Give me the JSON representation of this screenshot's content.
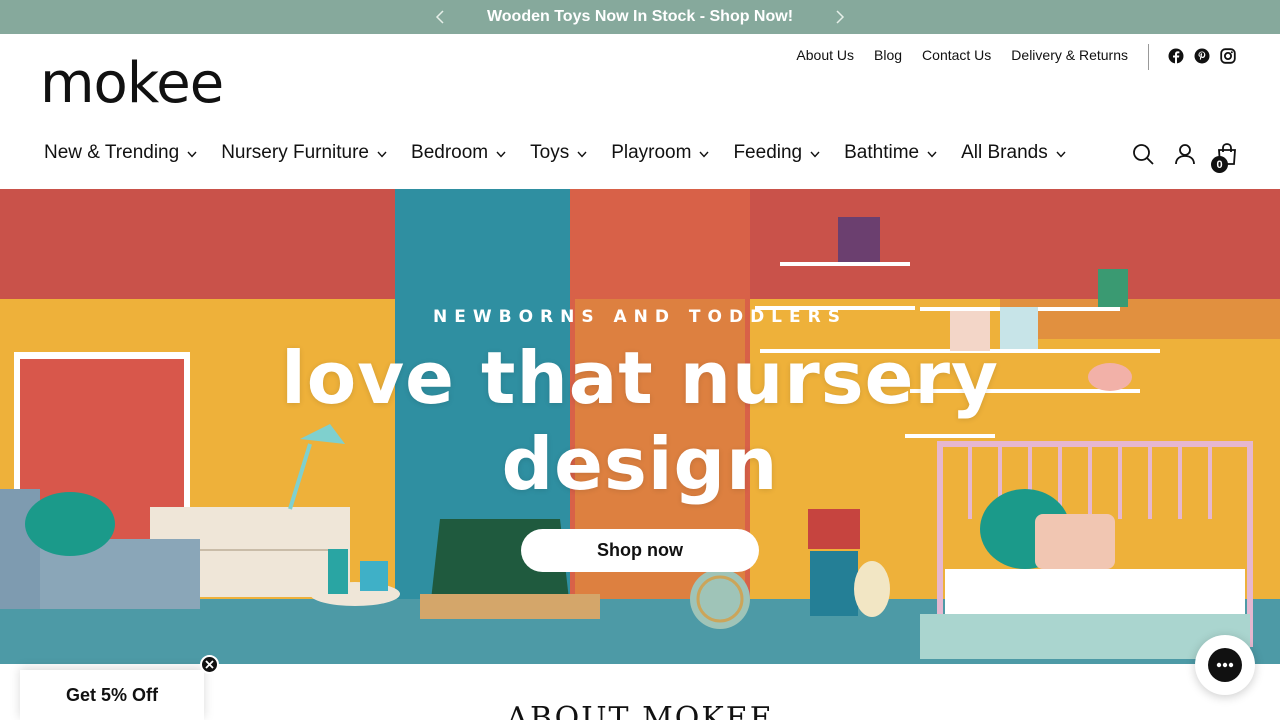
{
  "announcement": {
    "text": "Wooden Toys Now In Stock - Shop Now!",
    "prev_icon": "chevron-left-icon",
    "next_icon": "chevron-right-icon"
  },
  "header": {
    "logo": "mokee",
    "utility_links": [
      "About Us",
      "Blog",
      "Contact Us",
      "Delivery & Returns"
    ],
    "socials": [
      "facebook-icon",
      "pinterest-icon",
      "instagram-icon"
    ],
    "nav": [
      "New & Trending",
      "Nursery Furniture",
      "Bedroom",
      "Toys",
      "Playroom",
      "Feeding",
      "Bathtime",
      "All Brands"
    ],
    "icons": [
      "search-icon",
      "account-icon",
      "cart-icon"
    ],
    "cart_count": "0"
  },
  "hero": {
    "eyebrow": "NEWBORNS AND TODDLERS",
    "title_line1": "love that nursery",
    "title_line2": "design",
    "button": "Shop now"
  },
  "popup": {
    "label": "Get 5% Off",
    "close_icon": "close-icon"
  },
  "section": {
    "heading": "ABOUT MOKEE"
  },
  "chat": {
    "icon": "chat-icon"
  },
  "colors": {
    "announcement_bg": "#86a99c",
    "text": "#111111",
    "wall_red": "#c9524a",
    "wall_yellow": "#eeb13a",
    "wall_teal": "#2f8fa1",
    "floor": "#4d9aa6"
  }
}
